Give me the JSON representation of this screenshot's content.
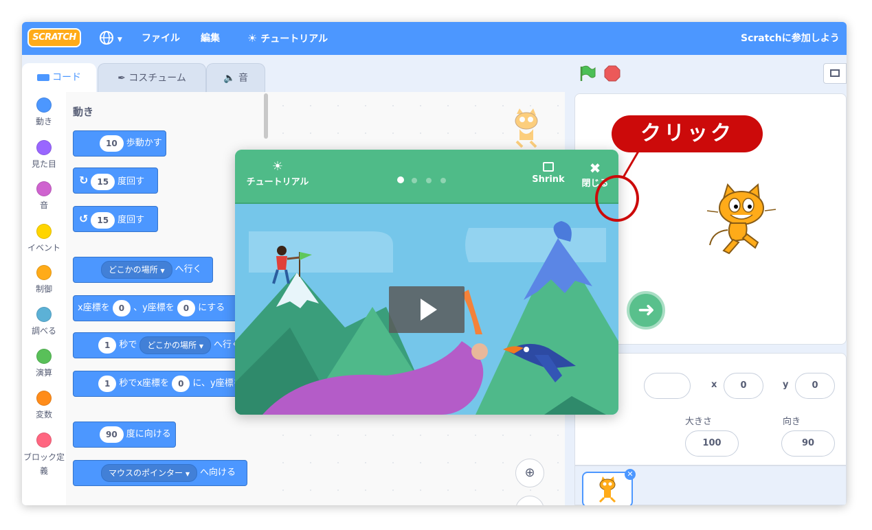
{
  "menubar": {
    "logo": "SCRATCH",
    "language_icon": "globe-icon",
    "file": "ファイル",
    "edit": "編集",
    "tutorials": "チュートリアル",
    "join": "Scratchに参加しよう"
  },
  "tabs": {
    "code": "コード",
    "costumes": "コスチューム",
    "sounds": "音"
  },
  "categories": [
    {
      "label": "動き",
      "color": "#4c97ff"
    },
    {
      "label": "見た目",
      "color": "#9966ff"
    },
    {
      "label": "音",
      "color": "#cf63cf"
    },
    {
      "label": "イベント",
      "color": "#ffd500"
    },
    {
      "label": "制御",
      "color": "#ffab19"
    },
    {
      "label": "調べる",
      "color": "#5cb1d6"
    },
    {
      "label": "演算",
      "color": "#59c059"
    },
    {
      "label": "変数",
      "color": "#ff8c1a"
    },
    {
      "label": "ブロック定義",
      "color": "#ff6680"
    }
  ],
  "palette": {
    "title": "動き",
    "blocks": {
      "move_value": "10",
      "move_text": "歩動かす",
      "turn_right_value": "15",
      "turn_right_text": "度回す",
      "turn_left_value": "15",
      "turn_left_text": "度回す",
      "goto_menu": "どこかの場所",
      "goto_text": "へ行く",
      "gotoxy_x_label": "x座標を",
      "gotoxy_x": "0",
      "gotoxy_sep": "、y座標を",
      "gotoxy_y": "0",
      "gotoxy_text": "にする",
      "glide_secs": "1",
      "glide_text1": "秒で",
      "glide_menu": "どこかの場所",
      "glide_text2": "へ行く",
      "glidexy_secs": "1",
      "glidexy_text1": "秒でx座標を",
      "glidexy_x": "0",
      "glidexy_text2": "に、y座標を",
      "point_value": "90",
      "point_text": "度に向ける",
      "pointto_menu": "マウスのポインター",
      "pointto_text": "へ向ける"
    }
  },
  "tutorial": {
    "title": "チュートリアル",
    "shrink": "Shrink",
    "close": "閉じる",
    "pages": 4,
    "current_page": 1
  },
  "sprite_info": {
    "x_label": "x",
    "x_value": "0",
    "y_label": "y",
    "y_value": "0",
    "size_label": "大きさ",
    "size_value": "100",
    "direction_label": "向き",
    "direction_value": "90"
  },
  "callout": "クリック"
}
